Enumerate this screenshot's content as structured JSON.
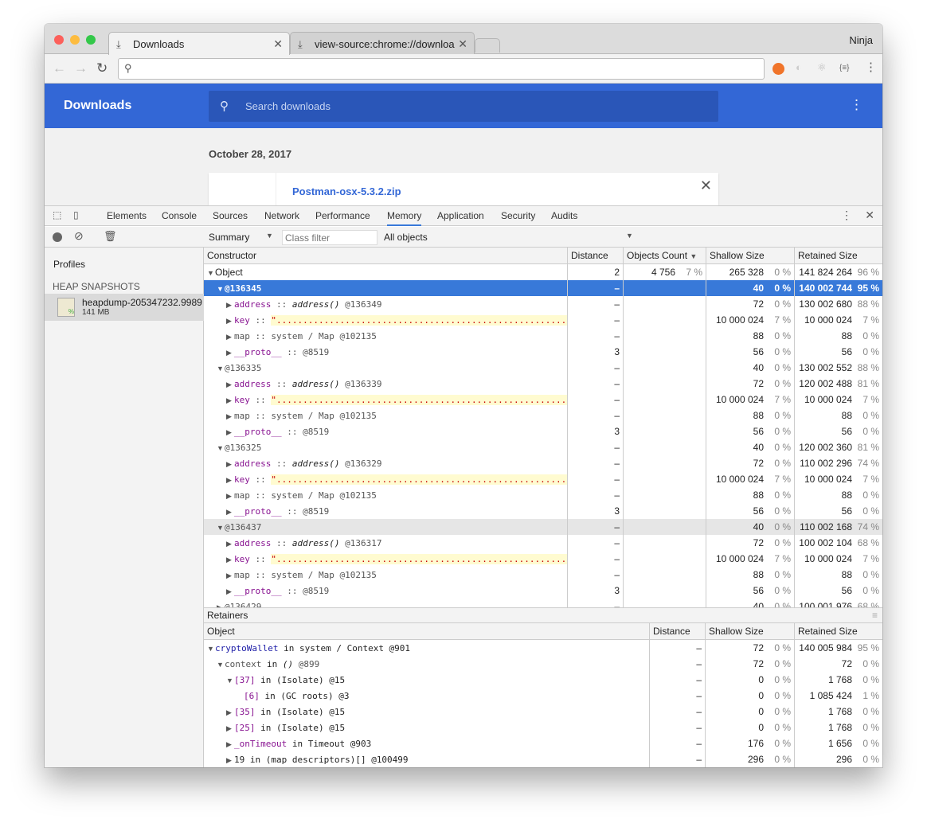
{
  "browser": {
    "profile": "Ninja",
    "tabs": [
      {
        "label": "Downloads",
        "active": true
      },
      {
        "label": "view-source:chrome://downloa"
      }
    ],
    "address": ""
  },
  "downloads": {
    "title": "Downloads",
    "search_placeholder": "Search downloads",
    "date": "October 28, 2017",
    "file": "Postman-osx-5.3.2.zip"
  },
  "devtools": {
    "tabs": [
      "Elements",
      "Console",
      "Sources",
      "Network",
      "Performance",
      "Memory",
      "Application",
      "Security",
      "Audits"
    ],
    "active_tab": "Memory",
    "toolbar": {
      "view": "Summary",
      "class_filter_placeholder": "Class filter",
      "objects": "All objects"
    },
    "sidebar": {
      "profiles": "Profiles",
      "section": "HEAP SNAPSHOTS",
      "snapshot_name": "heapdump-205347232.9989",
      "snapshot_size": "141 MB"
    },
    "columns": {
      "constructor": "Constructor",
      "distance": "Distance",
      "count": "Objects Count",
      "shallow": "Shallow Size",
      "retained": "Retained Size"
    },
    "rows": [
      {
        "i": 0,
        "a": "d",
        "s": [
          [
            "Object",
            ""
          ]
        ],
        "d": "2",
        "c": "4 756",
        "cp": "7 %",
        "sh": "265 328",
        "shp": "0 %",
        "r": "141 824 264",
        "rp": "96 %"
      },
      {
        "i": 1,
        "a": "d",
        "s": [
          [
            "@136345",
            ""
          ]
        ],
        "d": "–",
        "sh": "40",
        "shp": "0 %",
        "r": "140 002 744",
        "rp": "95 %",
        "sel": true
      },
      {
        "i": 2,
        "a": "r",
        "s": [
          [
            "address",
            "pk"
          ],
          [
            " :: ",
            "gray"
          ],
          [
            "address()",
            "it"
          ],
          [
            " @136349",
            "gray"
          ]
        ],
        "d": "–",
        "sh": "72",
        "shp": "0 %",
        "r": "130 002 680",
        "rp": "88 %"
      },
      {
        "i": 2,
        "a": "r",
        "s": [
          [
            "key",
            "pk"
          ],
          [
            " :: ",
            "gray"
          ],
          [
            "\"..........................................................",
            "keyv"
          ]
        ],
        "d": "–",
        "sh": "10 000 024",
        "shp": "7 %",
        "r": "10 000 024",
        "rp": "7 %"
      },
      {
        "i": 2,
        "a": "r",
        "s": [
          [
            "map",
            "gray"
          ],
          [
            " :: system / Map @102135",
            "gray"
          ]
        ],
        "d": "–",
        "sh": "88",
        "shp": "0 %",
        "r": "88",
        "rp": "0 %"
      },
      {
        "i": 2,
        "a": "r",
        "s": [
          [
            "__proto__",
            "pk"
          ],
          [
            " :: @8519",
            "gray"
          ]
        ],
        "d": "3",
        "sh": "56",
        "shp": "0 %",
        "r": "56",
        "rp": "0 %"
      },
      {
        "i": 1,
        "a": "d",
        "s": [
          [
            "@136335",
            "gray"
          ]
        ],
        "d": "–",
        "sh": "40",
        "shp": "0 %",
        "r": "130 002 552",
        "rp": "88 %"
      },
      {
        "i": 2,
        "a": "r",
        "s": [
          [
            "address",
            "pk"
          ],
          [
            " :: ",
            "gray"
          ],
          [
            "address()",
            "it"
          ],
          [
            " @136339",
            "gray"
          ]
        ],
        "d": "–",
        "sh": "72",
        "shp": "0 %",
        "r": "120 002 488",
        "rp": "81 %"
      },
      {
        "i": 2,
        "a": "r",
        "s": [
          [
            "key",
            "pk"
          ],
          [
            " :: ",
            "gray"
          ],
          [
            "\"..........................................................",
            "keyv"
          ]
        ],
        "d": "–",
        "sh": "10 000 024",
        "shp": "7 %",
        "r": "10 000 024",
        "rp": "7 %"
      },
      {
        "i": 2,
        "a": "r",
        "s": [
          [
            "map",
            "gray"
          ],
          [
            " :: system / Map @102135",
            "gray"
          ]
        ],
        "d": "–",
        "sh": "88",
        "shp": "0 %",
        "r": "88",
        "rp": "0 %"
      },
      {
        "i": 2,
        "a": "r",
        "s": [
          [
            "__proto__",
            "pk"
          ],
          [
            " :: @8519",
            "gray"
          ]
        ],
        "d": "3",
        "sh": "56",
        "shp": "0 %",
        "r": "56",
        "rp": "0 %"
      },
      {
        "i": 1,
        "a": "d",
        "s": [
          [
            "@136325",
            "gray"
          ]
        ],
        "d": "–",
        "sh": "40",
        "shp": "0 %",
        "r": "120 002 360",
        "rp": "81 %"
      },
      {
        "i": 2,
        "a": "r",
        "s": [
          [
            "address",
            "pk"
          ],
          [
            " :: ",
            "gray"
          ],
          [
            "address()",
            "it"
          ],
          [
            " @136329",
            "gray"
          ]
        ],
        "d": "–",
        "sh": "72",
        "shp": "0 %",
        "r": "110 002 296",
        "rp": "74 %"
      },
      {
        "i": 2,
        "a": "r",
        "s": [
          [
            "key",
            "pk"
          ],
          [
            " :: ",
            "gray"
          ],
          [
            "\"..........................................................",
            "keyv"
          ]
        ],
        "d": "–",
        "sh": "10 000 024",
        "shp": "7 %",
        "r": "10 000 024",
        "rp": "7 %"
      },
      {
        "i": 2,
        "a": "r",
        "s": [
          [
            "map",
            "gray"
          ],
          [
            " :: system / Map @102135",
            "gray"
          ]
        ],
        "d": "–",
        "sh": "88",
        "shp": "0 %",
        "r": "88",
        "rp": "0 %"
      },
      {
        "i": 2,
        "a": "r",
        "s": [
          [
            "__proto__",
            "pk"
          ],
          [
            " :: @8519",
            "gray"
          ]
        ],
        "d": "3",
        "sh": "56",
        "shp": "0 %",
        "r": "56",
        "rp": "0 %"
      },
      {
        "i": 1,
        "a": "d",
        "s": [
          [
            "@136437",
            "gray"
          ]
        ],
        "d": "–",
        "sh": "40",
        "shp": "0 %",
        "r": "110 002 168",
        "rp": "74 %",
        "hov": true
      },
      {
        "i": 2,
        "a": "r",
        "s": [
          [
            "address",
            "pk"
          ],
          [
            " :: ",
            "gray"
          ],
          [
            "address()",
            "it"
          ],
          [
            " @136317",
            "gray"
          ]
        ],
        "d": "–",
        "sh": "72",
        "shp": "0 %",
        "r": "100 002 104",
        "rp": "68 %"
      },
      {
        "i": 2,
        "a": "r",
        "s": [
          [
            "key",
            "pk"
          ],
          [
            " :: ",
            "gray"
          ],
          [
            "\"..........................................................",
            "keyv"
          ]
        ],
        "d": "–",
        "sh": "10 000 024",
        "shp": "7 %",
        "r": "10 000 024",
        "rp": "7 %"
      },
      {
        "i": 2,
        "a": "r",
        "s": [
          [
            "map",
            "gray"
          ],
          [
            " :: system / Map @102135",
            "gray"
          ]
        ],
        "d": "–",
        "sh": "88",
        "shp": "0 %",
        "r": "88",
        "rp": "0 %"
      },
      {
        "i": 2,
        "a": "r",
        "s": [
          [
            "__proto__",
            "pk"
          ],
          [
            " :: @8519",
            "gray"
          ]
        ],
        "d": "3",
        "sh": "56",
        "shp": "0 %",
        "r": "56",
        "rp": "0 %"
      },
      {
        "i": 1,
        "a": "r",
        "s": [
          [
            "@136429",
            "gray"
          ]
        ],
        "d": "–",
        "sh": "40",
        "shp": "0 %",
        "r": "100 001 976",
        "rp": "68 %"
      }
    ],
    "retainers": {
      "title": "Retainers",
      "columns": {
        "object": "Object",
        "distance": "Distance",
        "shallow": "Shallow Size",
        "retained": "Retained Size"
      },
      "rows": [
        {
          "i": 0,
          "a": "d",
          "s": [
            [
              "cryptoWallet",
              "blue"
            ],
            [
              " in system / Context @901",
              ""
            ]
          ],
          "d": "–",
          "sh": "72",
          "shp": "0 %",
          "r": "140 005 984",
          "rp": "95 %"
        },
        {
          "i": 1,
          "a": "d",
          "s": [
            [
              "context",
              "gray"
            ],
            [
              " in ",
              ""
            ],
            [
              "()",
              "it"
            ],
            [
              " @899",
              "gray"
            ]
          ],
          "d": "–",
          "sh": "72",
          "shp": "0 %",
          "r": "72",
          "rp": "0 %"
        },
        {
          "i": 2,
          "a": "d",
          "s": [
            [
              "[37]",
              "pk"
            ],
            [
              " in (Isolate) @15",
              ""
            ]
          ],
          "d": "–",
          "sh": "0",
          "shp": "0 %",
          "r": "1 768",
          "rp": "0 %"
        },
        {
          "i": 3,
          "a": "",
          "s": [
            [
              "[6]",
              "pk"
            ],
            [
              " in (GC roots) @3",
              ""
            ]
          ],
          "d": "–",
          "sh": "0",
          "shp": "0 %",
          "r": "1 085 424",
          "rp": "1 %"
        },
        {
          "i": 2,
          "a": "r",
          "s": [
            [
              "[35]",
              "pk"
            ],
            [
              " in (Isolate) @15",
              ""
            ]
          ],
          "d": "–",
          "sh": "0",
          "shp": "0 %",
          "r": "1 768",
          "rp": "0 %"
        },
        {
          "i": 2,
          "a": "r",
          "s": [
            [
              "[25]",
              "pk"
            ],
            [
              " in (Isolate) @15",
              ""
            ]
          ],
          "d": "–",
          "sh": "0",
          "shp": "0 %",
          "r": "1 768",
          "rp": "0 %"
        },
        {
          "i": 2,
          "a": "r",
          "s": [
            [
              "_onTimeout",
              "pk"
            ],
            [
              " in Timeout @903",
              ""
            ]
          ],
          "d": "–",
          "sh": "176",
          "shp": "0 %",
          "r": "1 656",
          "rp": "0 %"
        },
        {
          "i": 2,
          "a": "r",
          "s": [
            [
              "19",
              ""
            ],
            [
              " in (map descriptors)[] @100499",
              ""
            ]
          ],
          "d": "–",
          "sh": "296",
          "shp": "0 %",
          "r": "296",
          "rp": "0 %"
        }
      ]
    }
  },
  "colors": {
    "accent": "#3367d6",
    "selection": "#3879d9",
    "property": "#881391"
  }
}
